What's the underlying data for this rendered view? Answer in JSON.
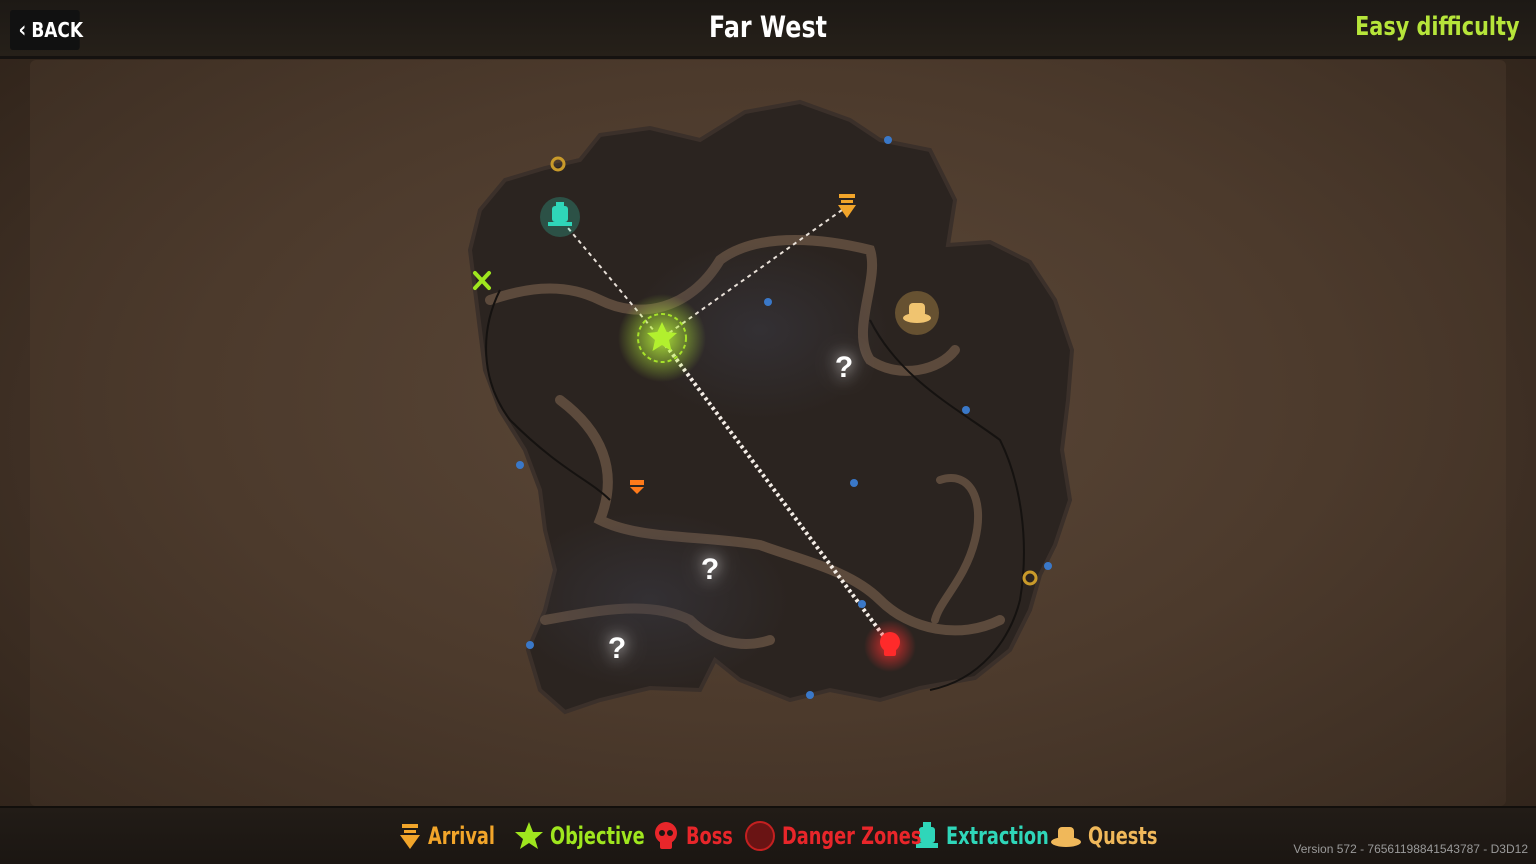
{
  "header": {
    "back_label": "BACK",
    "title": "Far West",
    "difficulty": "Easy difficulty"
  },
  "map": {
    "markers": [
      {
        "type": "question",
        "label": "?"
      },
      {
        "type": "question",
        "label": "?"
      },
      {
        "type": "question",
        "label": "?"
      }
    ]
  },
  "legend": {
    "items": [
      {
        "label": "Arrival",
        "color": "#f2a52a",
        "icon": "arrival-arrow-icon"
      },
      {
        "label": "Objective",
        "color": "#9fe61e",
        "icon": "star-icon"
      },
      {
        "label": "Boss",
        "color": "#e8262a",
        "icon": "skull-icon"
      },
      {
        "label": "Danger Zones",
        "color": "#e8262a",
        "icon": "danger-circle-icon"
      },
      {
        "label": "Extraction",
        "color": "#2fd6b9",
        "icon": "train-icon"
      },
      {
        "label": "Quests",
        "color": "#f0b85a",
        "icon": "cowboy-hat-icon"
      }
    ]
  },
  "footer": {
    "version": "Version 572 - 76561198841543787 - D3D12"
  },
  "colors": {
    "accent": "#b6e53a",
    "arrival": "#f2a52a",
    "objective": "#9fe61e",
    "boss": "#e8262a",
    "extraction": "#2fd6b9",
    "quests": "#f0b85a"
  }
}
